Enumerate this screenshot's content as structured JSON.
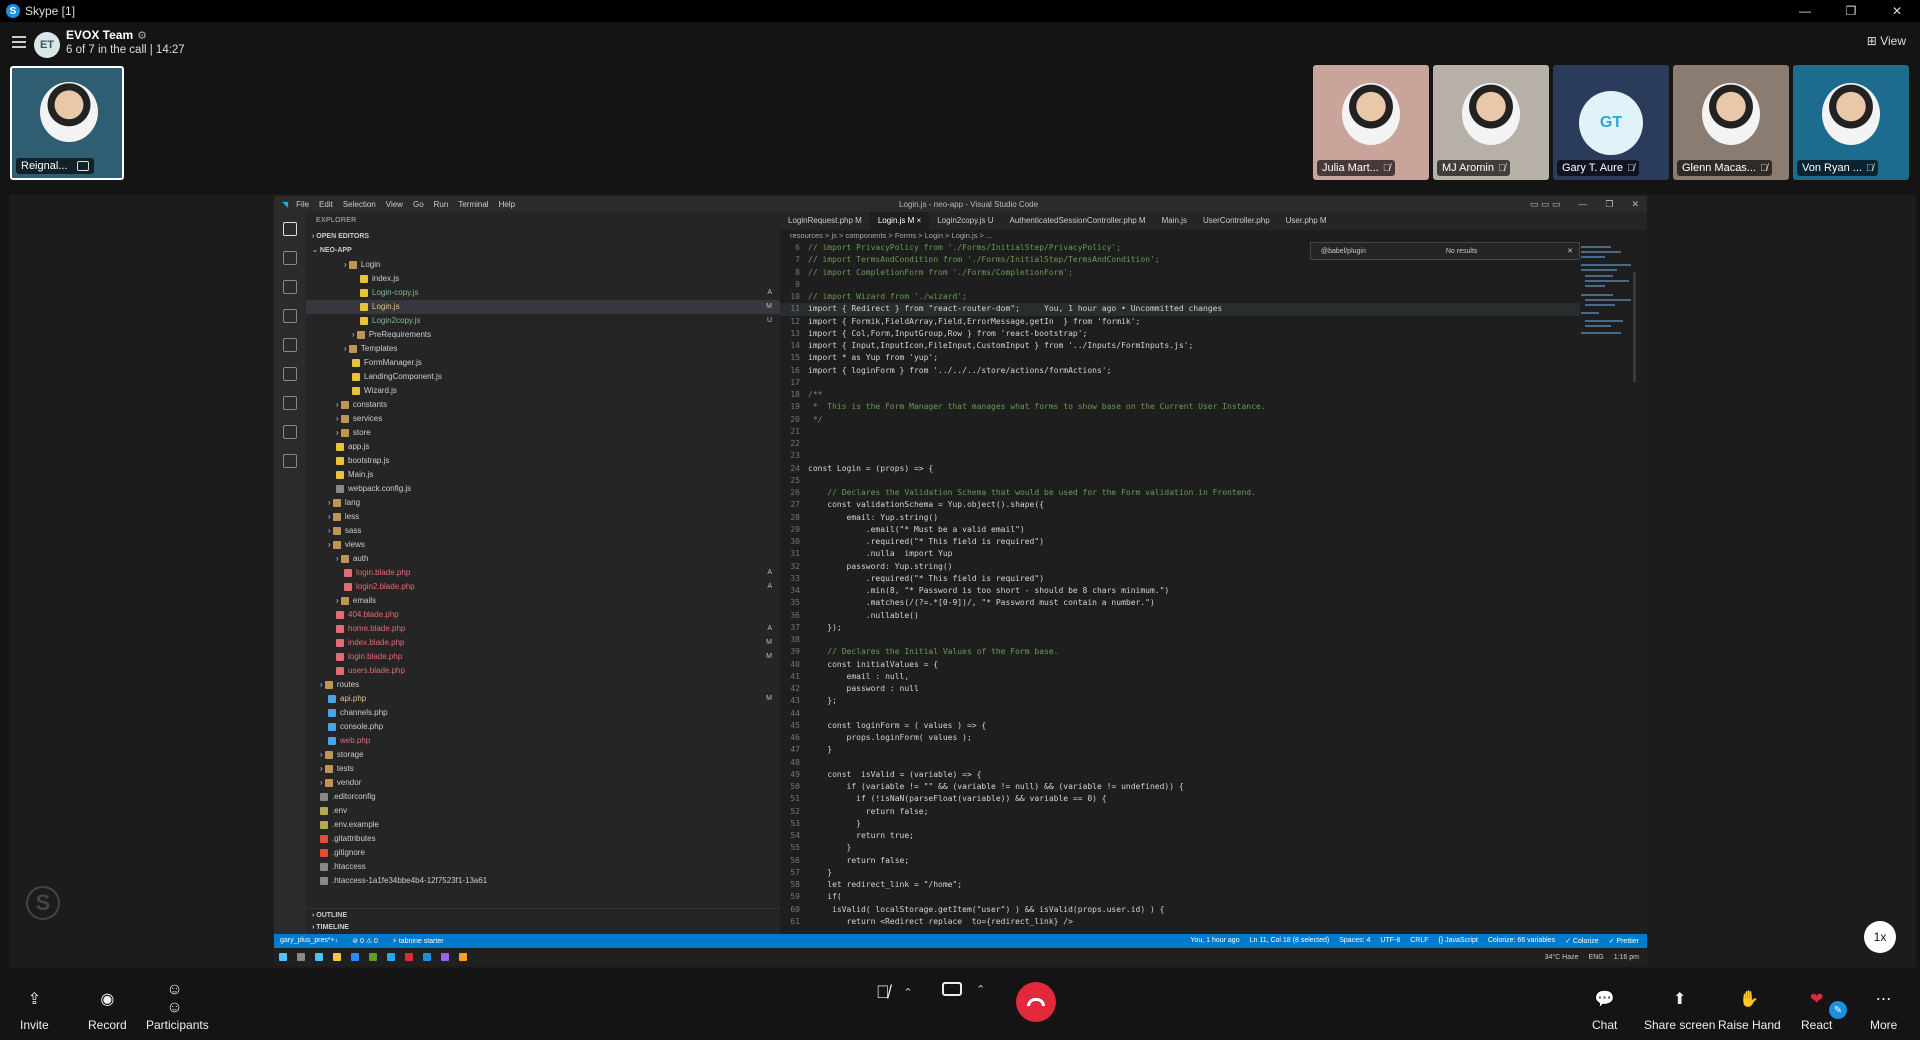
{
  "window": {
    "title": "Skype [1]"
  },
  "call": {
    "group_initials": "ET",
    "group_name": "EVOX Team",
    "info": "6 of 7 in the call | 14:27",
    "view_label": "View"
  },
  "self": {
    "name": "Reignal..."
  },
  "participants": [
    {
      "name": "Julia Mart...",
      "bg": "#c9a49a"
    },
    {
      "name": "MJ Aromin",
      "bg": "#b7b0a8"
    },
    {
      "name": "Gary T. Aure",
      "initials": "GT",
      "bg": "#2a3b5c"
    },
    {
      "name": "Glenn Macas...",
      "bg": "#8a7c70"
    },
    {
      "name": "Von Ryan ...",
      "bg": "#1d6b8e"
    }
  ],
  "vscode": {
    "menu": [
      "File",
      "Edit",
      "Selection",
      "View",
      "Go",
      "Run",
      "Terminal",
      "Help"
    ],
    "window_title": "Login.js - neo-app - Visual Studio Code",
    "explorer_title": "EXPLORER",
    "open_editors": "OPEN EDITORS",
    "project": "NEO-APP",
    "tree": [
      {
        "name": "Login",
        "indent": 4,
        "type": "folder"
      },
      {
        "name": "index.js",
        "indent": 6,
        "type": "js"
      },
      {
        "name": "Login-copy.js",
        "indent": 6,
        "type": "js",
        "status": "A"
      },
      {
        "name": "Login.js",
        "indent": 6,
        "type": "js",
        "status": "M",
        "selected": true
      },
      {
        "name": "Login2copy.js",
        "indent": 6,
        "type": "js",
        "status": "U"
      },
      {
        "name": "PreRequirements",
        "indent": 5,
        "type": "folder"
      },
      {
        "name": "Templates",
        "indent": 4,
        "type": "folder"
      },
      {
        "name": "FormManager.js",
        "indent": 5,
        "type": "js"
      },
      {
        "name": "LandingComponent.js",
        "indent": 5,
        "type": "js"
      },
      {
        "name": "Wizard.js",
        "indent": 5,
        "type": "js"
      },
      {
        "name": "constants",
        "indent": 3,
        "type": "folder"
      },
      {
        "name": "services",
        "indent": 3,
        "type": "folder"
      },
      {
        "name": "store",
        "indent": 3,
        "type": "folder"
      },
      {
        "name": "app.js",
        "indent": 3,
        "type": "js"
      },
      {
        "name": "bootstrap.js",
        "indent": 3,
        "type": "js"
      },
      {
        "name": "Main.js",
        "indent": 3,
        "type": "js"
      },
      {
        "name": "webpack.config.js",
        "indent": 3,
        "type": "cfg"
      },
      {
        "name": "lang",
        "indent": 2,
        "type": "folder"
      },
      {
        "name": "less",
        "indent": 2,
        "type": "folder"
      },
      {
        "name": "sass",
        "indent": 2,
        "type": "folder"
      },
      {
        "name": "views",
        "indent": 2,
        "type": "folder"
      },
      {
        "name": "auth",
        "indent": 3,
        "type": "folder"
      },
      {
        "name": "login.blade.php",
        "indent": 4,
        "type": "php",
        "status": "A"
      },
      {
        "name": "login2.blade.php",
        "indent": 4,
        "type": "php",
        "status": "A"
      },
      {
        "name": "emails",
        "indent": 3,
        "type": "folder"
      },
      {
        "name": "404.blade.php",
        "indent": 3,
        "type": "php"
      },
      {
        "name": "home.blade.php",
        "indent": 3,
        "type": "php",
        "status": "A"
      },
      {
        "name": "index.blade.php",
        "indent": 3,
        "type": "php",
        "status": "M"
      },
      {
        "name": "login.blade.php",
        "indent": 3,
        "type": "php",
        "status": "M"
      },
      {
        "name": "users.blade.php",
        "indent": 3,
        "type": "php"
      },
      {
        "name": "routes",
        "indent": 1,
        "type": "folder"
      },
      {
        "name": "api.php",
        "indent": 2,
        "type": "php2",
        "status": "M"
      },
      {
        "name": "channels.php",
        "indent": 2,
        "type": "php2"
      },
      {
        "name": "console.php",
        "indent": 2,
        "type": "php2"
      },
      {
        "name": "web.php",
        "indent": 2,
        "type": "php2"
      },
      {
        "name": "storage",
        "indent": 1,
        "type": "folder"
      },
      {
        "name": "tests",
        "indent": 1,
        "type": "folder"
      },
      {
        "name": "vendor",
        "indent": 1,
        "type": "folder"
      },
      {
        "name": ".editorconfig",
        "indent": 1,
        "type": "cfg"
      },
      {
        "name": ".env",
        "indent": 1,
        "type": "env"
      },
      {
        "name": ".env.example",
        "indent": 1,
        "type": "env"
      },
      {
        "name": ".gitattributes",
        "indent": 1,
        "type": "git"
      },
      {
        "name": ".gitignore",
        "indent": 1,
        "type": "git"
      },
      {
        "name": ".htaccess",
        "indent": 1,
        "type": "cfg"
      },
      {
        "name": ".htaccess-1a1fe34bbe4b4-12f7523f1-13a61",
        "indent": 1,
        "type": "cfg"
      }
    ],
    "outline": "OUTLINE",
    "timeline": "TIMELINE",
    "tabs": [
      {
        "label": "LoginRequest.php M"
      },
      {
        "label": "Login.js M ×",
        "active": true
      },
      {
        "label": "Login2copy.js U"
      },
      {
        "label": "AuthenticatedSessionController.php M"
      },
      {
        "label": "Main.js"
      },
      {
        "label": "UserController.php"
      },
      {
        "label": "User.php M"
      }
    ],
    "breadcrumb": "resources > js > components > Forms > Login > Login.js > ...",
    "find": {
      "query": "@babel/plugin",
      "result": "No results"
    },
    "code": [
      {
        "n": "6",
        "t": "// import PrivacyPolicy from './Forms/InitialStep/PrivacyPolicy';",
        "c": true
      },
      {
        "n": "7",
        "t": "// import TermsAndCondition from './Forms/InitialStep/TermsAndCondition';",
        "c": true
      },
      {
        "n": "8",
        "t": "// import CompletionForm from './Forms/CompletionForm';",
        "c": true
      },
      {
        "n": "9",
        "t": ""
      },
      {
        "n": "10",
        "t": "// import Wizard from './wizard';",
        "c": true
      },
      {
        "n": "11",
        "t": "import { Redirect } from \"react-router-dom\";     You, 1 hour ago • Uncommitted changes"
      },
      {
        "n": "12",
        "t": "import { Formik,FieldArray,Field,ErrorMessage,getIn  } from 'formik';"
      },
      {
        "n": "13",
        "t": "import { Col,Form,InputGroup,Row } from 'react-bootstrap';"
      },
      {
        "n": "14",
        "t": "import { Input,InputIcon,FileInput,CustomInput } from '../Inputs/FormInputs.js';"
      },
      {
        "n": "15",
        "t": "import * as Yup from 'yup';"
      },
      {
        "n": "16",
        "t": "import { loginForm } from '../../../store/actions/formActions';"
      },
      {
        "n": "17",
        "t": ""
      },
      {
        "n": "18",
        "t": "/**",
        "c": true
      },
      {
        "n": "19",
        "t": " *  This is the Form Manager that manages what forms to show base on the Current User Instance.",
        "c": true
      },
      {
        "n": "20",
        "t": " */",
        "c": true
      },
      {
        "n": "21",
        "t": ""
      },
      {
        "n": "22",
        "t": ""
      },
      {
        "n": "23",
        "t": ""
      },
      {
        "n": "24",
        "t": "const Login = (props) => {"
      },
      {
        "n": "25",
        "t": ""
      },
      {
        "n": "26",
        "t": "    // Declares the Validation Schema that would be used for the Form validation in Frontend.",
        "c": true
      },
      {
        "n": "27",
        "t": "    const validationSchema = Yup.object().shape({"
      },
      {
        "n": "28",
        "t": "        email: Yup.string()"
      },
      {
        "n": "29",
        "t": "            .email(\"* Must be a valid email\")"
      },
      {
        "n": "30",
        "t": "            .required(\"* This field is required\")"
      },
      {
        "n": "31",
        "t": "            .nulla  import Yup"
      },
      {
        "n": "32",
        "t": "        password: Yup.string()"
      },
      {
        "n": "33",
        "t": "            .required(\"* This field is required\")"
      },
      {
        "n": "34",
        "t": "            .min(8, \"* Password is too short - should be 8 chars minimum.\")"
      },
      {
        "n": "35",
        "t": "            .matches(/(?=.*[0-9])/, \"* Password must contain a number.\")"
      },
      {
        "n": "36",
        "t": "            .nullable()"
      },
      {
        "n": "37",
        "t": "    });"
      },
      {
        "n": "38",
        "t": ""
      },
      {
        "n": "39",
        "t": "    // Declares the Initial Values of the Form base.",
        "c": true
      },
      {
        "n": "40",
        "t": "    const initialValues = {"
      },
      {
        "n": "41",
        "t": "        email : null,"
      },
      {
        "n": "42",
        "t": "        password : null"
      },
      {
        "n": "43",
        "t": "    };"
      },
      {
        "n": "44",
        "t": ""
      },
      {
        "n": "45",
        "t": "    const loginForm = ( values ) => {"
      },
      {
        "n": "46",
        "t": "        props.loginForm( values );"
      },
      {
        "n": "47",
        "t": "    }"
      },
      {
        "n": "48",
        "t": ""
      },
      {
        "n": "49",
        "t": "    const  isValid = (variable) => {"
      },
      {
        "n": "50",
        "t": "        if (variable != \"\" && (variable != null) && (variable != undefined)) {"
      },
      {
        "n": "51",
        "t": "          if (!isNaN(parseFloat(variable)) && variable == 0) {"
      },
      {
        "n": "52",
        "t": "            return false;"
      },
      {
        "n": "53",
        "t": "          }"
      },
      {
        "n": "54",
        "t": "          return true;"
      },
      {
        "n": "55",
        "t": "        }"
      },
      {
        "n": "56",
        "t": "        return false;"
      },
      {
        "n": "57",
        "t": "    }"
      },
      {
        "n": "58",
        "t": "    let redirect_link = \"/home\";"
      },
      {
        "n": "59",
        "t": "    if("
      },
      {
        "n": "60",
        "t": "     isValid( localStorage.getItem(\"user\") ) && isValid(props.user.id) ) {"
      },
      {
        "n": "61",
        "t": "        return <Redirect replace  to={redirect_link} />"
      }
    ],
    "status_left": [
      "gary_plus_pres*+↓",
      "⊘ 0 ⚠ 0",
      "⚡ tabnine starter"
    ],
    "status_right": [
      "You, 1 hour ago",
      "Ln 11, Col 18 (8 selected)",
      "Spaces: 4",
      "UTF-8",
      "CRLF",
      "{} JavaScript",
      "Colorize: 66 variables",
      "✓ Colorize",
      "✓ Prettier"
    ],
    "tray": [
      "34°C Haze",
      "ENG",
      "1:16 pm"
    ]
  },
  "speed": "1x",
  "bottom": {
    "invite": "Invite",
    "record": "Record",
    "participants": "Participants",
    "chat": "Chat",
    "share": "Share screen",
    "raise": "Raise Hand",
    "react": "React",
    "more": "More"
  }
}
